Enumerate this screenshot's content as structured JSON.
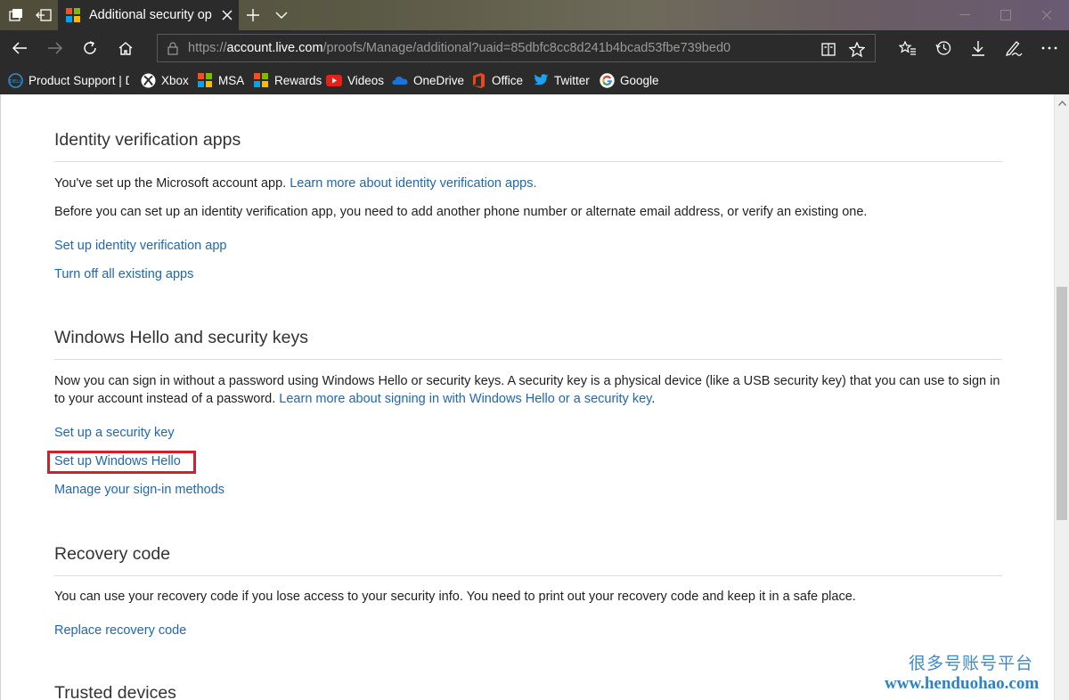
{
  "browser": {
    "tab_title": "Additional security opt",
    "url_prefix": "https://",
    "url_host": "account.live.com",
    "url_path": "/proofs/Manage/additional?uaid=85dbfc8cc8d241b4bcad53fbe739bed0"
  },
  "favorites": [
    {
      "label": "Product Support | De",
      "icon": "dell-icon"
    },
    {
      "label": "Xbox",
      "icon": "xbox-icon"
    },
    {
      "label": "MSA",
      "icon": "microsoft-icon"
    },
    {
      "label": "Rewards",
      "icon": "microsoft-icon"
    },
    {
      "label": "Videos",
      "icon": "youtube-icon"
    },
    {
      "label": "OneDrive",
      "icon": "onedrive-icon"
    },
    {
      "label": "Office",
      "icon": "office-icon"
    },
    {
      "label": "Twitter",
      "icon": "twitter-icon"
    },
    {
      "label": "Google",
      "icon": "google-icon"
    }
  ],
  "sections": {
    "identity": {
      "heading": "Identity verification apps",
      "p1_text": "You've set up the Microsoft account app. ",
      "p1_link": "Learn more about identity verification apps.",
      "p2": "Before you can set up an identity verification app, you need to add another phone number or alternate email address, or verify an existing one.",
      "action1": "Set up identity verification app",
      "action2": "Turn off all existing apps"
    },
    "hello": {
      "heading": "Windows Hello and security keys",
      "p_text": "Now you can sign in without a password using Windows Hello or security keys. A security key is a physical device (like a USB security key) that you can use to sign in to your account instead of a password. ",
      "p_link": "Learn more about signing in with Windows Hello or a security key",
      "p_end": ".",
      "action1": "Set up a security key",
      "action2": "Set up Windows Hello",
      "action3": "Manage your sign-in methods"
    },
    "recovery": {
      "heading": "Recovery code",
      "p": "You can use your recovery code if you lose access to your security info. You need to print out your recovery code and keep it in a safe place.",
      "action1": "Replace recovery code"
    },
    "trusted": {
      "heading": "Trusted devices"
    }
  },
  "watermark": {
    "line1": "很多号账号平台",
    "line2": "www.henduohao.com"
  },
  "colors": {
    "link": "#1f67b0",
    "highlight": "#d0202a",
    "chrome_dark": "#2b2b2b"
  }
}
